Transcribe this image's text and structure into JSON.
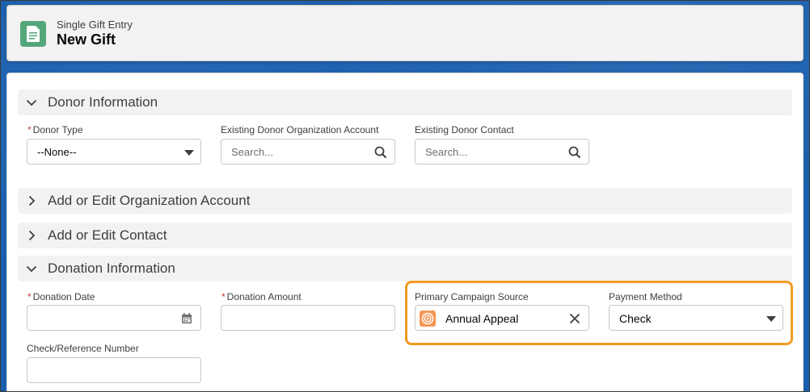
{
  "header": {
    "eyebrow": "Single Gift Entry",
    "title": "New Gift",
    "icon": "gift-entry-document-icon",
    "icon_color": "#54a77b"
  },
  "sections": {
    "donor_info": {
      "label": "Donor Information",
      "expanded": true
    },
    "org_account": {
      "label": "Add or Edit Organization Account",
      "expanded": false
    },
    "contact": {
      "label": "Add or Edit Contact",
      "expanded": false
    },
    "donation_info": {
      "label": "Donation Information",
      "expanded": true
    }
  },
  "donor": {
    "donor_type": {
      "label": "Donor Type",
      "required": true,
      "value": "--None--"
    },
    "org_account": {
      "label": "Existing Donor Organization Account",
      "placeholder": "Search..."
    },
    "contact": {
      "label": "Existing Donor Contact",
      "placeholder": "Search..."
    }
  },
  "donation": {
    "date": {
      "label": "Donation Date",
      "required": true,
      "value": ""
    },
    "amount": {
      "label": "Donation Amount",
      "required": true,
      "value": ""
    },
    "campaign": {
      "label": "Primary Campaign Source",
      "value": "Annual Appeal",
      "icon": "campaign-target-icon",
      "icon_color": "#f49756"
    },
    "payment": {
      "label": "Payment Method",
      "value": "Check"
    },
    "check_ref": {
      "label": "Check/Reference Number",
      "value": ""
    }
  },
  "colors": {
    "required": "#c23934",
    "highlight": "#f39b23"
  }
}
